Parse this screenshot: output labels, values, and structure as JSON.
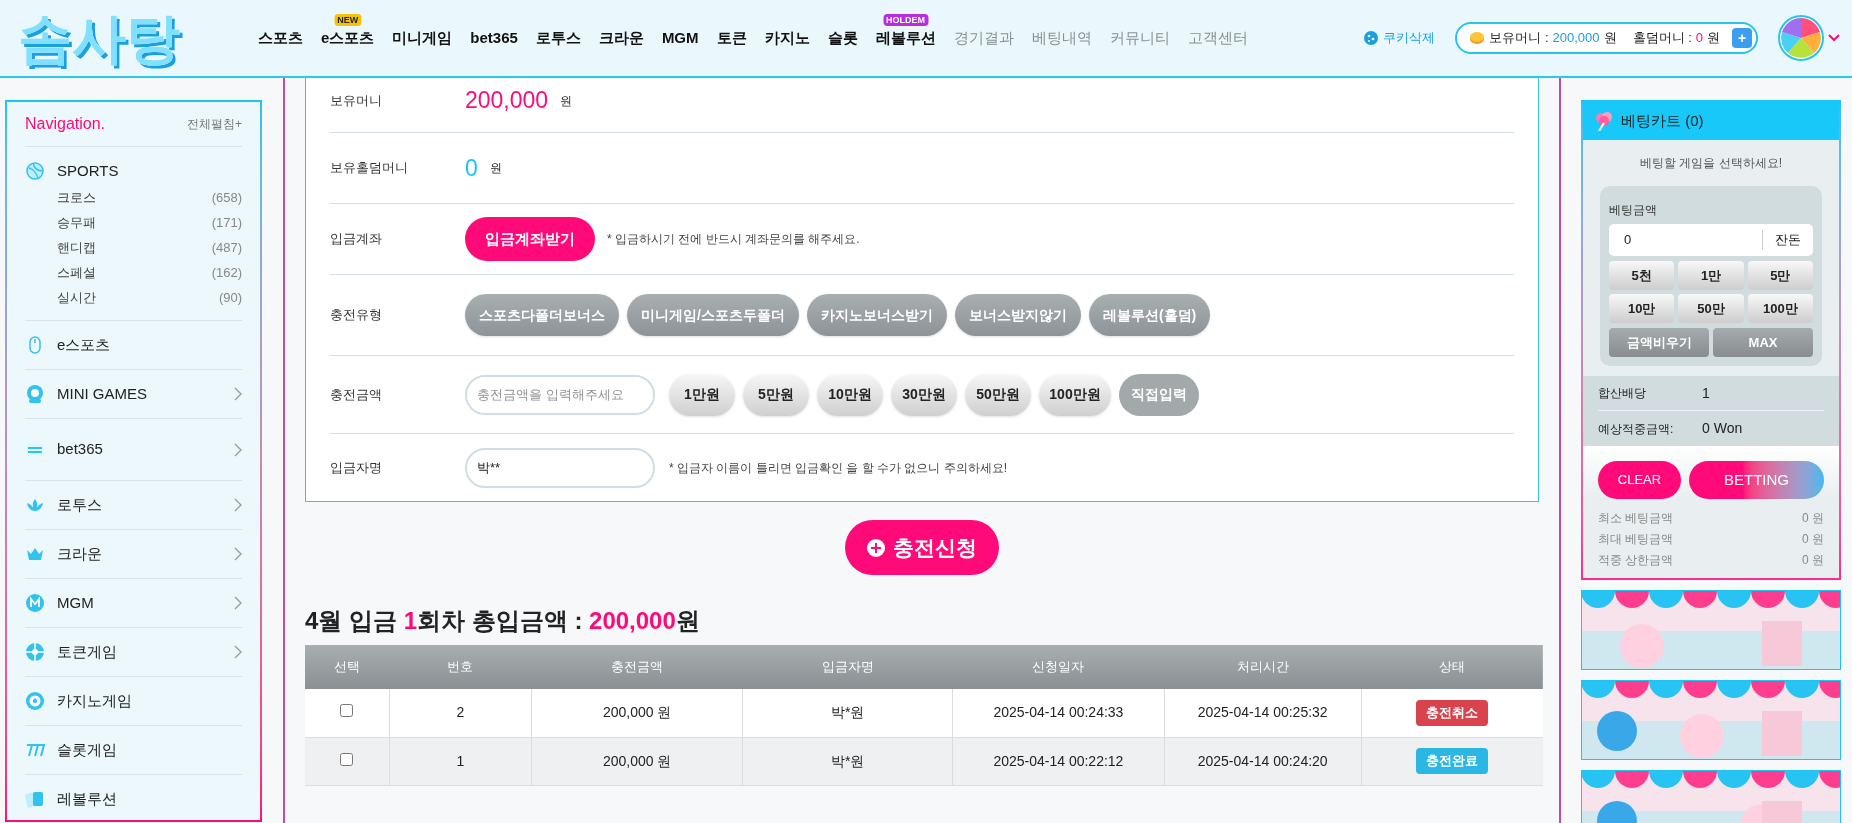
{
  "header": {
    "logo": "솜사탕",
    "nav": [
      {
        "label": "스포츠",
        "secondary": false
      },
      {
        "label": "e스포츠",
        "secondary": false,
        "badge": "NEW",
        "color": "#f5c400"
      },
      {
        "label": "미니게임",
        "secondary": false
      },
      {
        "label": "bet365",
        "secondary": false
      },
      {
        "label": "로투스",
        "secondary": false
      },
      {
        "label": "크라운",
        "secondary": false
      },
      {
        "label": "MGM",
        "secondary": false
      },
      {
        "label": "토큰",
        "secondary": false
      },
      {
        "label": "카지노",
        "secondary": false
      },
      {
        "label": "슬롯",
        "secondary": false
      },
      {
        "label": "레볼루션",
        "secondary": false,
        "badge": "HOLDEM",
        "color": "#b62ee0"
      },
      {
        "label": "경기결과",
        "secondary": true
      },
      {
        "label": "베팅내역",
        "secondary": true
      },
      {
        "label": "커뮤니티",
        "secondary": true
      },
      {
        "label": "고객센터",
        "secondary": true
      }
    ],
    "cookie_button": "쿠키삭제",
    "balance": {
      "money_label": "보유머니 :",
      "money": "200,000",
      "money_unit": "원",
      "holdem_label": "홀덤머니 :",
      "holdem": "0",
      "holdem_unit": "원",
      "plus": "+"
    }
  },
  "sidebar": {
    "title": "Navigation.",
    "expand_all": "전체펼침+",
    "items": [
      {
        "label": "SPORTS",
        "expandable": false,
        "children": [
          {
            "label": "크로스",
            "count": "(658)"
          },
          {
            "label": "승무패",
            "count": "(171)"
          },
          {
            "label": "핸디캡",
            "count": "(487)"
          },
          {
            "label": "스페셜",
            "count": "(162)"
          },
          {
            "label": "실시간",
            "count": "(90)"
          }
        ]
      },
      {
        "label": "e스포츠",
        "expandable": false
      },
      {
        "label": "MINI GAMES",
        "expandable": true
      },
      {
        "label": "bet365",
        "expandable": true
      },
      {
        "label": "로투스",
        "expandable": true
      },
      {
        "label": "크라운",
        "expandable": true
      },
      {
        "label": "MGM",
        "expandable": true
      },
      {
        "label": "토큰게임",
        "expandable": true
      },
      {
        "label": "카지노게임",
        "expandable": false
      },
      {
        "label": "슬롯게임",
        "expandable": false
      },
      {
        "label": "레볼루션",
        "expandable": false
      }
    ]
  },
  "form": {
    "rows": [
      {
        "kind": "amount",
        "label": "보유머니",
        "value": "200,000",
        "unit": "원",
        "color": "#ff0a78"
      },
      {
        "kind": "amount",
        "label": "보유홀덤머니",
        "value": "0",
        "unit": "원",
        "color": "#1ec3f5"
      },
      {
        "kind": "action",
        "label": "입금계좌",
        "button": "입금계좌받기",
        "note": "* 입금하시기 전에 반드시 계좌문의를 해주세요."
      },
      {
        "kind": "options",
        "label": "충전유형",
        "options": [
          "스포츠다폴더보너스",
          "미니게임/스포츠두폴더",
          "카지노보너스받기",
          "보너스받지않기",
          "레볼루션(홀덤)"
        ]
      },
      {
        "kind": "charge",
        "label": "충전금액",
        "placeholder": "충전금액을 입력해주세요",
        "options": [
          "1만원",
          "5만원",
          "10만원",
          "30만원",
          "50만원",
          "100만원"
        ],
        "direct": "직접입력"
      },
      {
        "kind": "name",
        "label": "입금자명",
        "value": "박**",
        "note": "* 입금자 이름이 틀리면 입금확인 을 할 수가 없으니 주의하세요!"
      }
    ],
    "submit": "충전신청"
  },
  "summary": "4월 입금 **1**회차 총입금액 : **200,000**원",
  "table": {
    "columns": [
      "선택",
      "번호",
      "충전금액",
      "입금자명",
      "신청일자",
      "처리시간",
      "상태"
    ],
    "rows": [
      {
        "checked": false,
        "cells": [
          "",
          "2",
          "200,000 원",
          "박*원",
          "2025-04-14 00:24:33",
          "2025-04-14 00:25:32"
        ],
        "status": "충전취소",
        "color": "#d9434d"
      },
      {
        "checked": false,
        "cells": [
          "",
          "1",
          "200,000 원",
          "박*원",
          "2025-04-14 00:22:12",
          "2025-04-14 00:24:20"
        ],
        "status": "충전완료",
        "color": "#2bb7e3"
      }
    ]
  },
  "cart": {
    "title": "베팅카트 (0)",
    "message": "베팅할 게임을 선택하세요!",
    "amount_label": "베팅금액",
    "amount": "0",
    "change": "잔돈",
    "quick": [
      "5천",
      "1만",
      "5만",
      "10만",
      "50만",
      "100만"
    ],
    "clear_amount": "금액비우기",
    "max": "MAX",
    "odds_label": "합산배당",
    "odds": "1",
    "expected_label": "예상적중금액:",
    "expected": "0 Won",
    "clear": "CLEAR",
    "bet": "BETTING",
    "limits": [
      {
        "label": "최소 베팅금액",
        "value": "0 원"
      },
      {
        "label": "최대 베팅금액",
        "value": "0 원"
      },
      {
        "label": "적중 상한금액",
        "value": "0 원"
      }
    ]
  }
}
